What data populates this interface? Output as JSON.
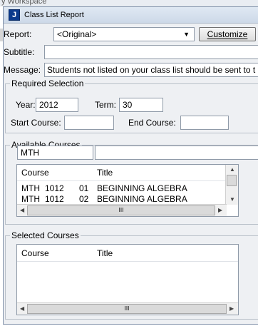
{
  "background": {
    "title_fragment": "y Workspace"
  },
  "window": {
    "title": "Class List Report",
    "icon_letter": "J"
  },
  "report": {
    "label": "Report:",
    "value": "<Original>",
    "customize_label": "Customize"
  },
  "subtitle": {
    "label": "Subtitle:",
    "value": ""
  },
  "message": {
    "label": "Message:",
    "value": "Students not listed on your class list should be sent to t"
  },
  "required": {
    "legend": "Required Selection",
    "year_label": "Year:",
    "year_value": "2012",
    "term_label": "Term:",
    "term_value": "30",
    "start_label": "Start Course:",
    "start_value": "",
    "end_label": "End Course:",
    "end_value": ""
  },
  "available": {
    "legend": "Available Courses",
    "filter_value": "MTH",
    "headers": {
      "course": "Course",
      "title": "Title"
    },
    "rows": [
      {
        "subject": "MTH",
        "number": "1012",
        "section": "01",
        "title": "BEGINNING ALGEBRA"
      },
      {
        "subject": "MTH",
        "number": "1012",
        "section": "02",
        "title": "BEGINNING ALGEBRA"
      }
    ],
    "scroll_thumb_glyph": "III"
  },
  "selected": {
    "legend": "Selected Courses",
    "headers": {
      "course": "Course",
      "title": "Title"
    },
    "scroll_thumb_glyph": "III"
  }
}
